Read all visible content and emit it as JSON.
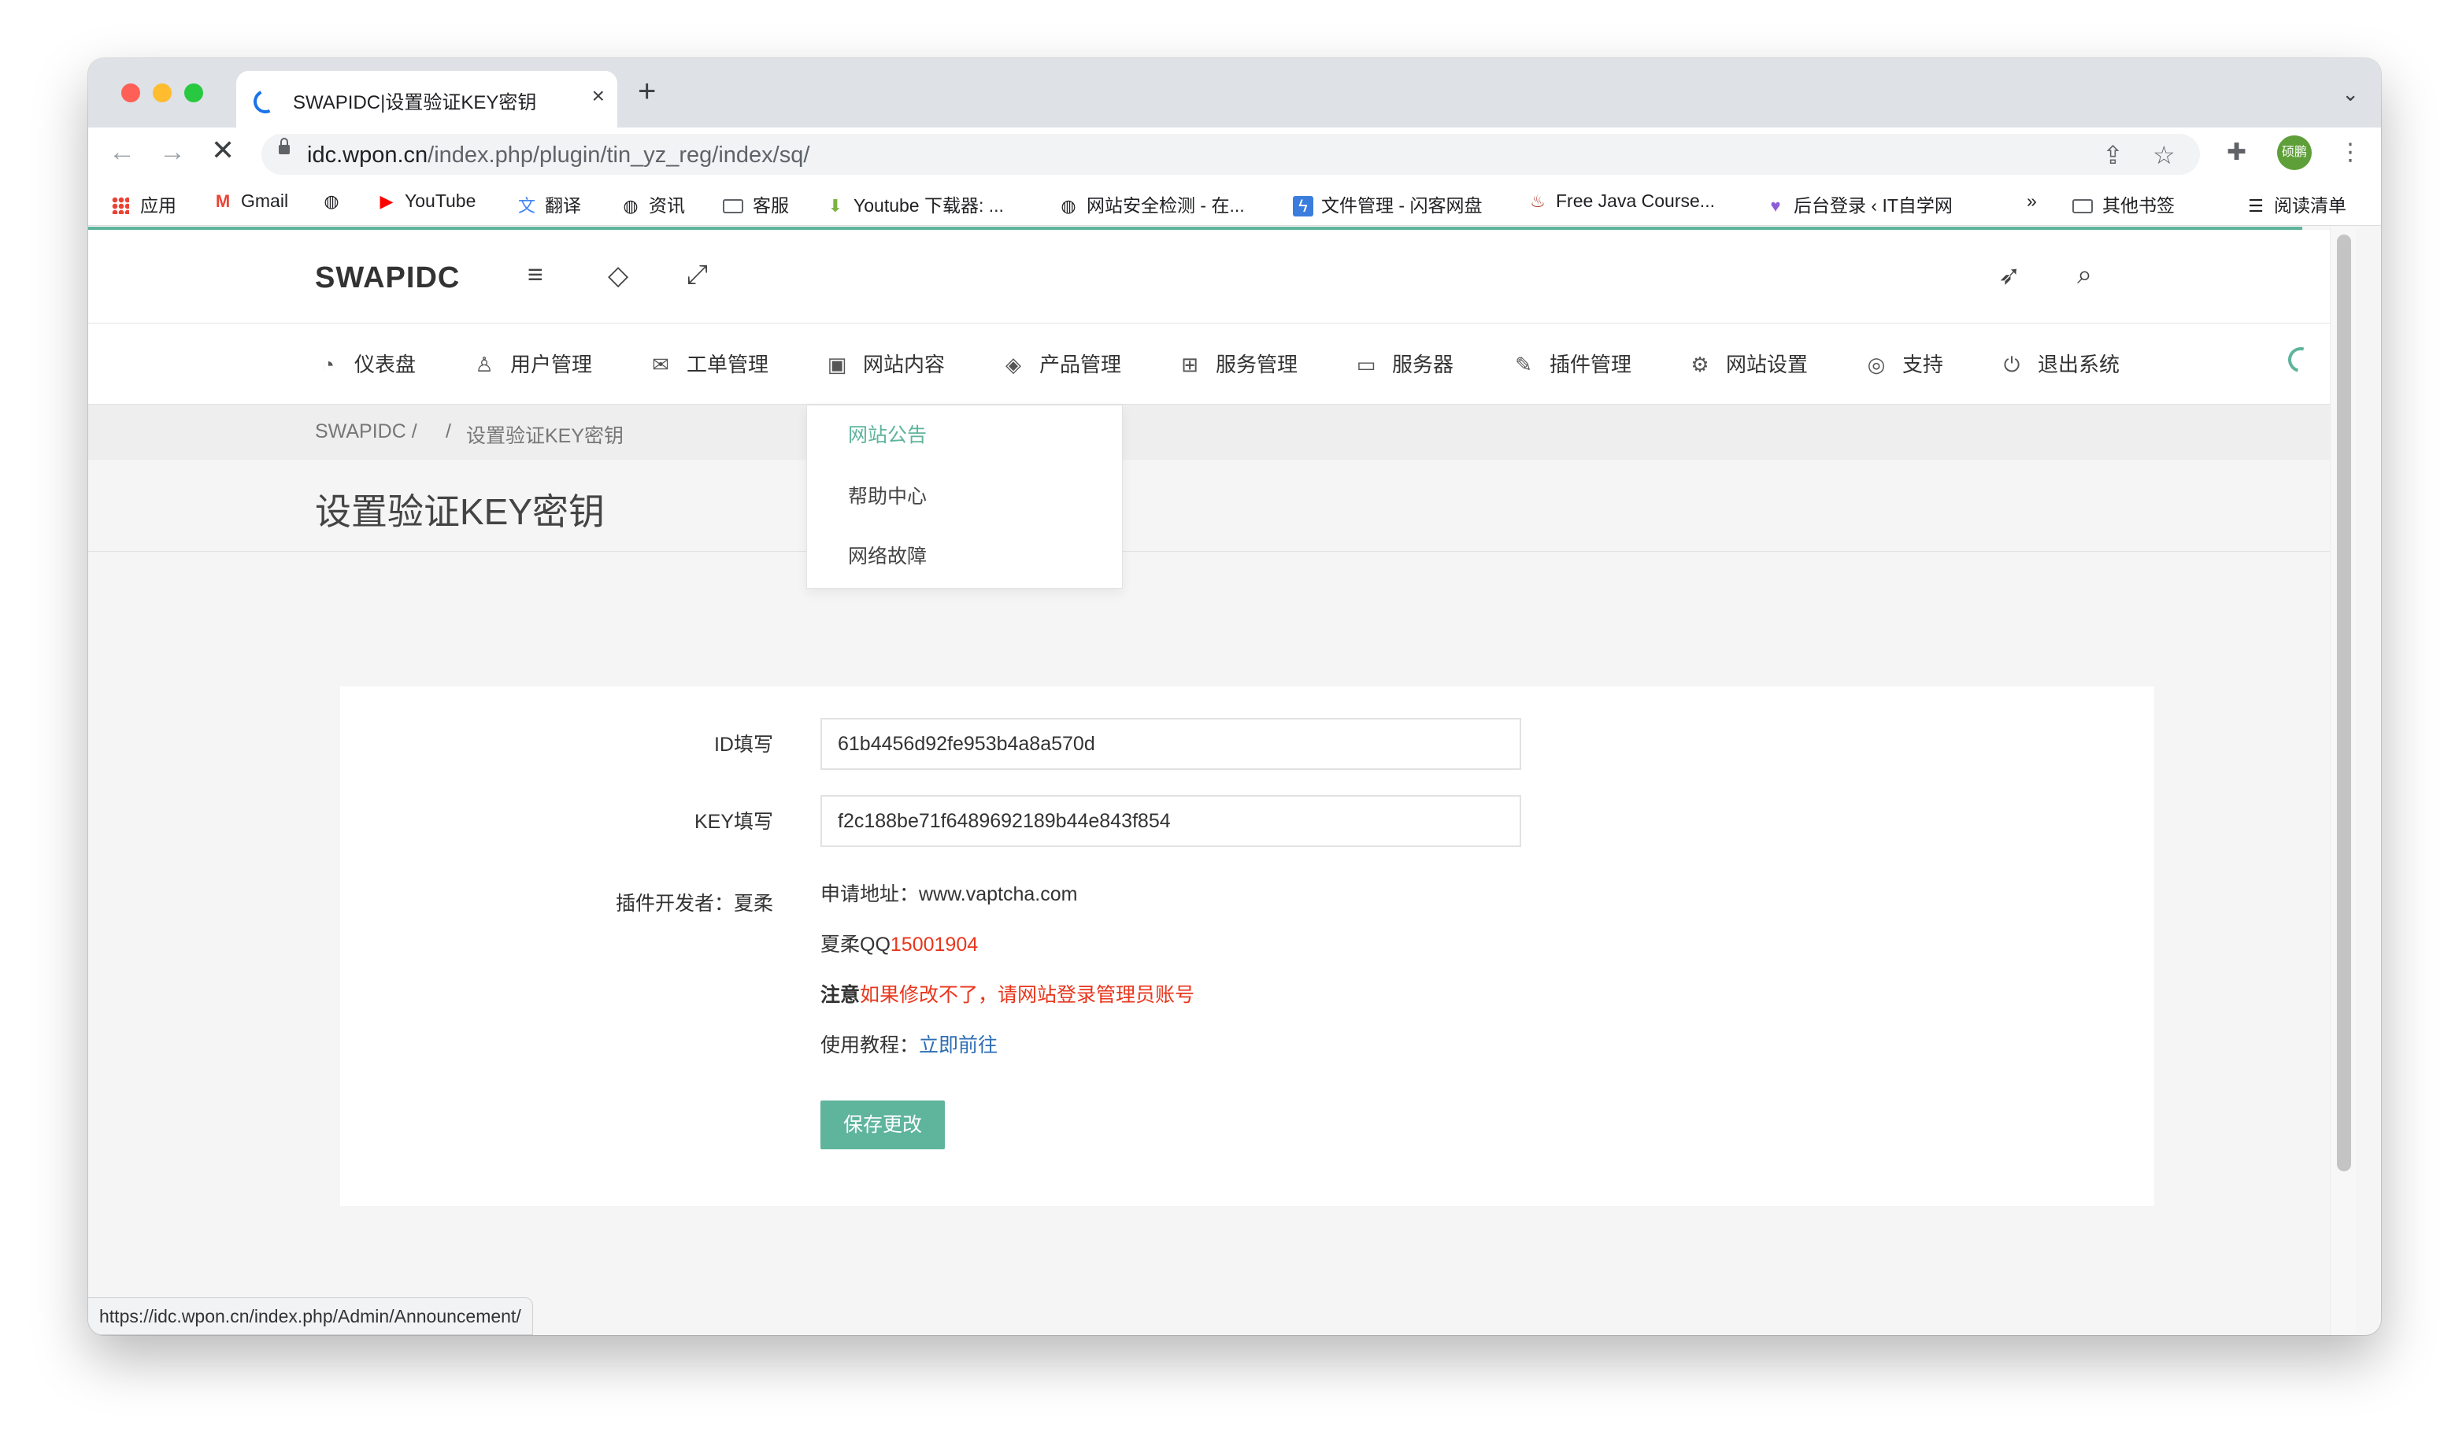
{
  "browser": {
    "tab_title": "SWAPIDC|设置验证KEY密钥",
    "tab_close": "×",
    "new_tab": "+",
    "url_domain": "idc.wpon.cn",
    "url_path": "/index.php/plugin/tin_yz_reg/index/sq/",
    "avatar_text": "硕鹏",
    "status_url": "https://idc.wpon.cn/index.php/Admin/Announcement/"
  },
  "bookmarks": [
    {
      "label": "应用",
      "icon": "apps-grid-icon"
    },
    {
      "label": "Gmail",
      "icon": "gmail-icon"
    },
    {
      "label": "",
      "icon": "globe-icon"
    },
    {
      "label": "YouTube",
      "icon": "youtube-icon"
    },
    {
      "label": "翻译",
      "icon": "translate-icon"
    },
    {
      "label": "资讯",
      "icon": "globe-icon"
    },
    {
      "label": "客服",
      "icon": "folder-icon"
    },
    {
      "label": "Youtube 下载器: ...",
      "icon": "download-icon"
    },
    {
      "label": "网站安全检测 - 在...",
      "icon": "globe-icon"
    },
    {
      "label": "文件管理 - 闪客网盘",
      "icon": "bolt-icon"
    },
    {
      "label": "Free Java Course...",
      "icon": "java-icon"
    },
    {
      "label": "后台登录 ‹ IT自学网",
      "icon": "heart-icon"
    },
    {
      "label": "»",
      "icon": "more-icon"
    },
    {
      "label": "其他书签",
      "icon": "folder-icon"
    },
    {
      "label": "阅读清单",
      "icon": "reading-list-icon"
    }
  ],
  "site": {
    "logo": "SWAPIDC",
    "menu": [
      {
        "label": "仪表盘",
        "icon": "dashboard-icon"
      },
      {
        "label": "用户管理",
        "icon": "user-icon"
      },
      {
        "label": "工单管理",
        "icon": "mail-open-icon"
      },
      {
        "label": "网站内容",
        "icon": "briefcase-icon"
      },
      {
        "label": "产品管理",
        "icon": "layers-icon"
      },
      {
        "label": "服务管理",
        "icon": "grid-icon"
      },
      {
        "label": "服务器",
        "icon": "inbox-icon"
      },
      {
        "label": "插件管理",
        "icon": "puzzle-icon"
      },
      {
        "label": "网站设置",
        "icon": "gear-icon"
      },
      {
        "label": "支持",
        "icon": "lifebuoy-icon"
      },
      {
        "label": "退出系统",
        "icon": "power-icon"
      }
    ],
    "dropdown": [
      "网站公告",
      "帮助中心",
      "网络故障"
    ],
    "breadcrumb": {
      "home": "SWAPIDC /",
      "sep": "/",
      "current": "设置验证KEY密钥"
    },
    "page_title": "设置验证KEY密钥"
  },
  "form": {
    "id_label": "ID填写",
    "id_value": "61b4456d92fe953b4a8a570d",
    "key_label": "KEY填写",
    "key_value": "f2c188be71f6489692189b44e843f854",
    "dev_label": "插件开发者：夏柔",
    "apply_prefix": "申请地址：",
    "apply_url": "www.vaptcha.com",
    "qq_prefix": "夏柔QQ",
    "qq_number": "15001904",
    "notice_prefix": "注意",
    "notice_text": "如果修改不了，请网站登录管理员账号",
    "tutorial_prefix": "使用教程：",
    "tutorial_link": "立即前往",
    "save_label": "保存更改"
  },
  "colors": {
    "accent": "#5fb49c",
    "warning": "#e8361c",
    "link": "#2e6db4"
  }
}
